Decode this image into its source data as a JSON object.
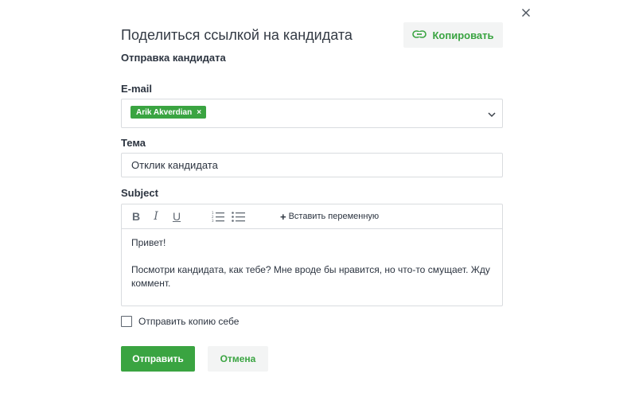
{
  "dialog": {
    "title": "Поделиться ссылкой на кандидата",
    "subtitle": "Отправка кандидата",
    "copy_button": {
      "label": "Копировать",
      "icon": "link-icon"
    },
    "close_icon": "close-icon"
  },
  "form": {
    "email": {
      "label": "E-mail",
      "tags": [
        {
          "label": "Arik Akverdian",
          "remove": "×"
        }
      ],
      "dropdown_icon": "chevron-down-icon"
    },
    "subject_ru": {
      "label": "Тема",
      "value": "Отклик кандидата"
    },
    "subject_en": {
      "label": "Subject",
      "toolbar": {
        "bold": "B",
        "italic": "I",
        "underline": "U",
        "ordered_list_icon": "ordered-list-icon",
        "unordered_list_icon": "unordered-list-icon",
        "insert_variable": "Вставить переменную"
      },
      "body": {
        "line1": "Привет!",
        "line2": "Посмотри кандидата, как тебе? Мне вроде бы нравится, но что-то смущает. Жду коммент."
      }
    },
    "copy_to_self": {
      "label": "Отправить копию себе",
      "checked": false
    }
  },
  "actions": {
    "send": "Отправить",
    "cancel": "Отмена"
  },
  "colors": {
    "accent": "#3aa441",
    "border": "#d9dcdf",
    "secondary_bg": "#f3f4f4",
    "text": "#2c3440"
  }
}
